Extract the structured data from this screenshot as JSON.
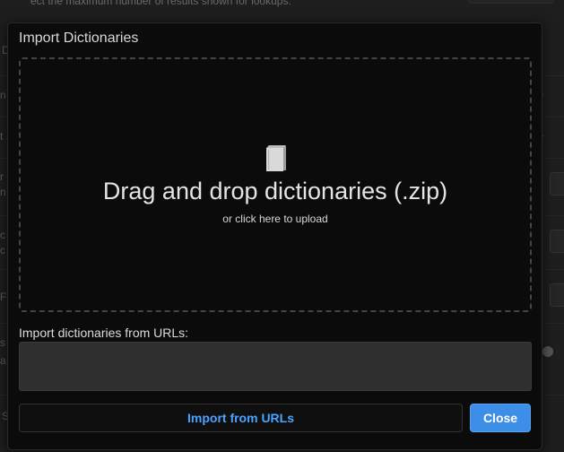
{
  "background": {
    "hint_text": "ect the maximum number of results shown for lookups.",
    "letters": [
      "D",
      "n",
      "t",
      "r",
      "n",
      "c",
      "c",
      "F",
      "s",
      "a",
      "S"
    ]
  },
  "dialog": {
    "title": "Import Dictionaries",
    "dropzone": {
      "icon": "book-icon",
      "title": "Drag and drop dictionaries (.zip)",
      "subtitle": "or click here to upload"
    },
    "url_label": "Import dictionaries from URLs:",
    "url_value": "",
    "import_button": "Import from URLs",
    "close_button": "Close"
  },
  "colors": {
    "dialog_bg": "#0b0b0c",
    "accent": "#3d8ee6",
    "link_text": "#4aa3ff"
  }
}
